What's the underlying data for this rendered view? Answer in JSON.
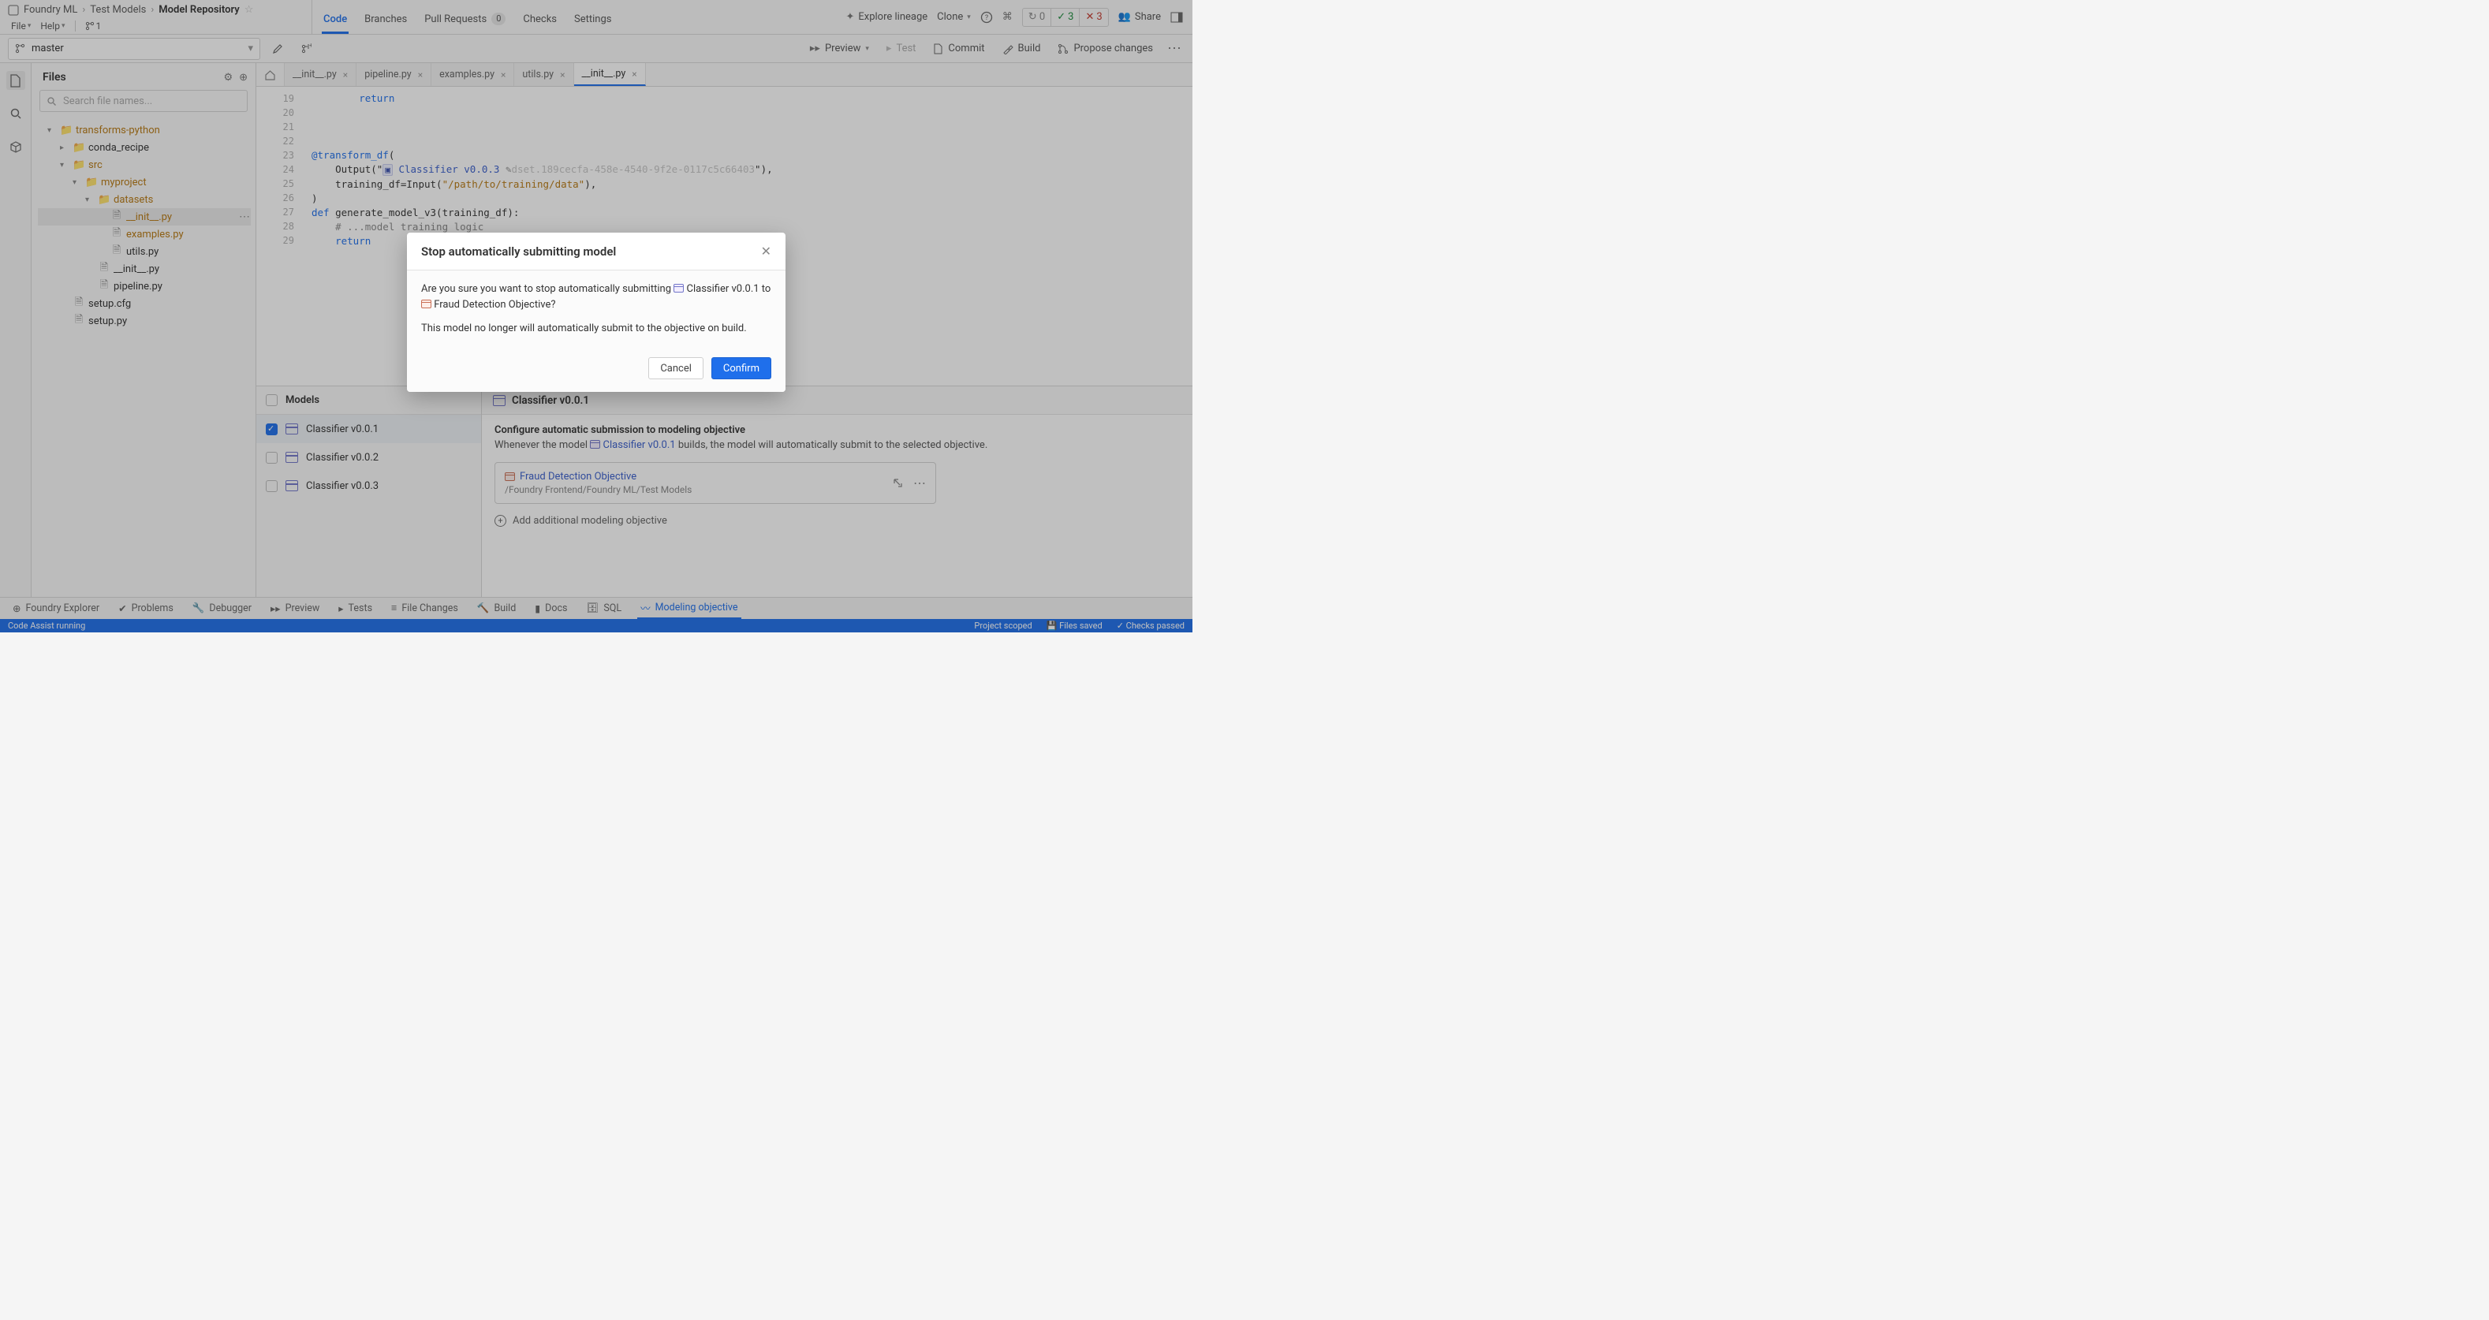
{
  "breadcrumb": {
    "root": "Foundry ML",
    "mid": "Test Models",
    "leaf": "Model Repository"
  },
  "menus": {
    "file": "File",
    "help": "Help",
    "branches_count": "1"
  },
  "header_tabs": {
    "code": "Code",
    "branches": "Branches",
    "prs": "Pull Requests",
    "prs_count": "0",
    "checks": "Checks",
    "settings": "Settings"
  },
  "header_right": {
    "explore": "Explore lineage",
    "clone": "Clone",
    "share": "Share",
    "status_ok": "3",
    "status_err": "3"
  },
  "toolbar": {
    "branch": "master",
    "preview": "Preview",
    "test": "Test",
    "commit": "Commit",
    "build": "Build",
    "propose": "Propose changes"
  },
  "sidebar": {
    "title": "Files",
    "search_placeholder": "Search file names...",
    "tree": {
      "n0": "transforms-python",
      "n1": "conda_recipe",
      "n2": "src",
      "n3": "myproject",
      "n4": "datasets",
      "n5": "__init__.py",
      "n6": "examples.py",
      "n7": "utils.py",
      "n8": "__init__.py",
      "n9": "pipeline.py",
      "n10": "setup.cfg",
      "n11": "setup.py"
    }
  },
  "editor_tabs": {
    "t0": "__init__.py",
    "t1": "pipeline.py",
    "t2": "examples.py",
    "t3": "utils.py",
    "t4": "__init__.py"
  },
  "code": {
    "l19": "        return",
    "l22a": "@transform_df",
    "l22b": "(",
    "l23a": "    Output(",
    "l23b": "\"",
    "l23_badge": "Classifier v0.0.3",
    "l23_dim": "dset.189cecfa-458e-4540-9f2e-0117c5c66403",
    "l23c": "\"),",
    "l24a": "    training_df=Input(",
    "l24b": "\"/path/to/training/data\"",
    "l24c": "),",
    "l25": ")",
    "l26a": "def ",
    "l26b": "generate_model_v3(training_df):",
    "l27": "    # ...model training logic",
    "l28": "    return"
  },
  "models": {
    "header": "Models",
    "m0": "Classifier v0.0.1",
    "m1": "Classifier v0.0.2",
    "m2": "Classifier v0.0.3",
    "right_title": "Classifier v0.0.1",
    "config_title": "Configure automatic submission to modeling objective",
    "config_sub_a": "Whenever the model ",
    "config_sub_link": "Classifier v0.0.1",
    "config_sub_b": " builds, the model will automatically submit to the selected objective.",
    "objective_name": "Fraud Detection Objective",
    "objective_path": "/Foundry Frontend/Foundry ML/Test Models",
    "add": "Add additional modeling objective"
  },
  "bottom": {
    "explorer": "Foundry Explorer",
    "problems": "Problems",
    "debugger": "Debugger",
    "preview": "Preview",
    "tests": "Tests",
    "filechanges": "File Changes",
    "build": "Build",
    "docs": "Docs",
    "sql": "SQL",
    "modeling": "Modeling objective"
  },
  "status": {
    "left": "Code Assist running",
    "scoped": "Project scoped",
    "saved": "Files saved",
    "checks": "Checks passed"
  },
  "modal": {
    "title": "Stop automatically submitting model",
    "p1a": "Are you sure you want to stop automatically submitting ",
    "p1_model": "Classifier v0.0.1",
    "p1b": " to ",
    "p1_obj": "Fraud Detection Objective",
    "p1c": "?",
    "p2": "This model no longer will automatically submit to the objective on build.",
    "cancel": "Cancel",
    "confirm": "Confirm"
  }
}
